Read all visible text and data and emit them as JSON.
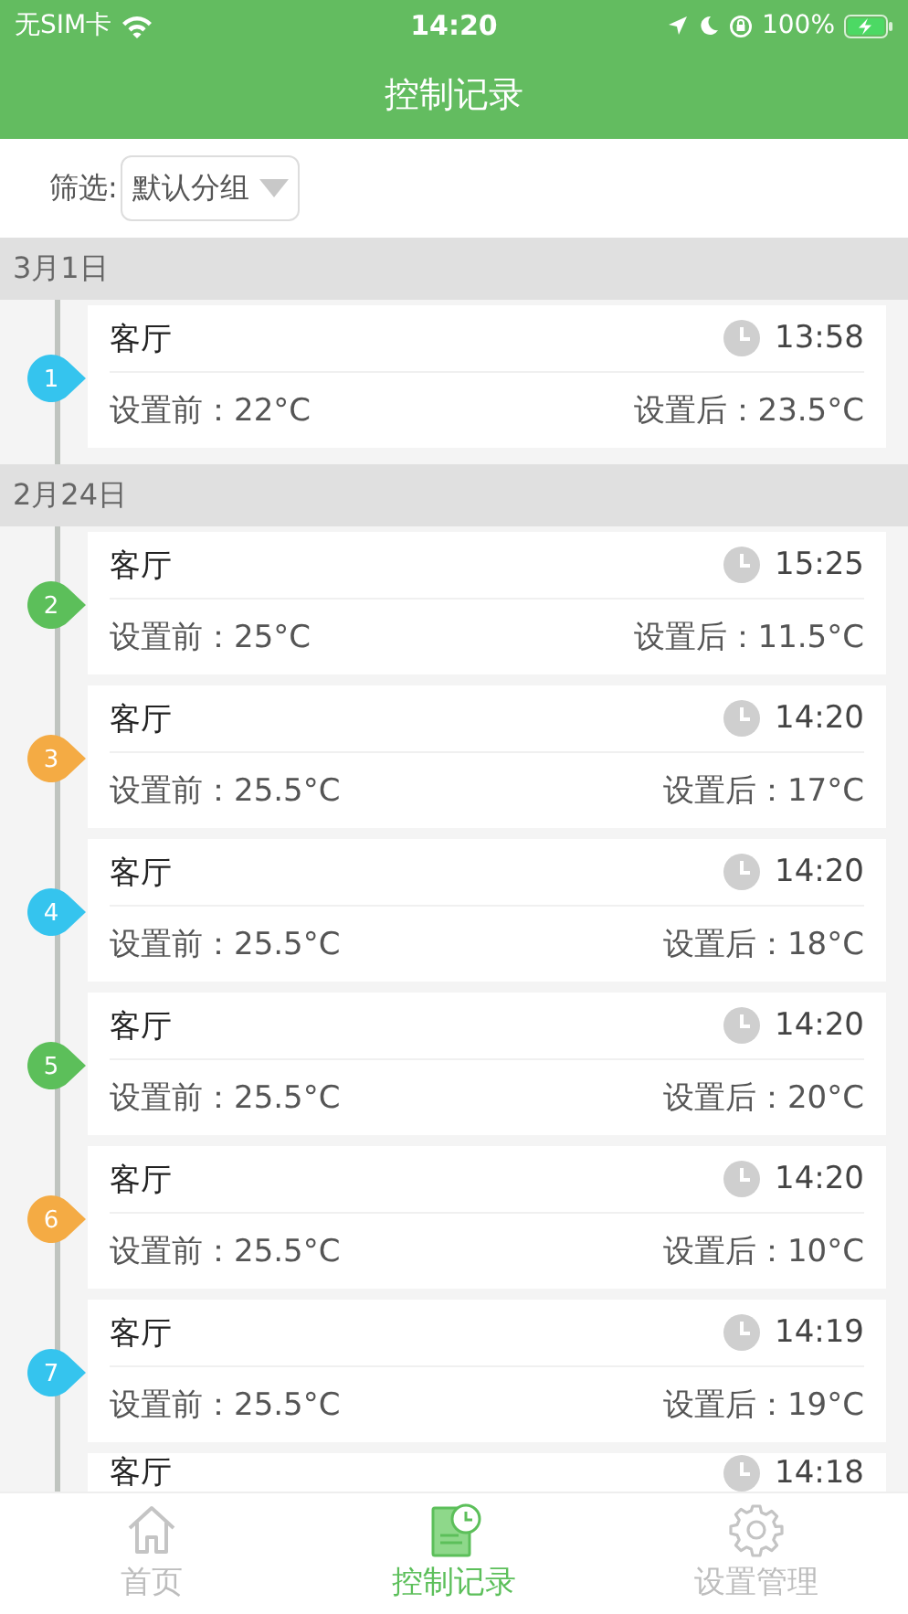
{
  "status_bar": {
    "carrier": "无SIM卡",
    "time": "14:20",
    "battery": "100%"
  },
  "header": {
    "title": "控制记录"
  },
  "filter": {
    "label": "筛选:",
    "value": "默认分组"
  },
  "groups": [
    {
      "date": "3月1日",
      "records": [
        {
          "kind": "full",
          "number": "1",
          "color": "#35c4ee",
          "room": "客厅",
          "time": "13:58",
          "before": "设置前：22°C",
          "after": "设置后：23.5°C"
        }
      ]
    },
    {
      "date": "2月24日",
      "records": [
        {
          "kind": "full",
          "number": "2",
          "color": "#5cbf5a",
          "room": "客厅",
          "time": "15:25",
          "before": "设置前：25°C",
          "after": "设置后：11.5°C"
        },
        {
          "kind": "full",
          "number": "3",
          "color": "#f4ab44",
          "room": "客厅",
          "time": "14:20",
          "before": "设置前：25.5°C",
          "after": "设置后：17°C"
        },
        {
          "kind": "full",
          "number": "4",
          "color": "#35c4ee",
          "room": "客厅",
          "time": "14:20",
          "before": "设置前：25.5°C",
          "after": "设置后：18°C"
        },
        {
          "kind": "full",
          "number": "5",
          "color": "#5cbf5a",
          "room": "客厅",
          "time": "14:20",
          "before": "设置前：25.5°C",
          "after": "设置后：20°C"
        },
        {
          "kind": "full",
          "number": "6",
          "color": "#f4ab44",
          "room": "客厅",
          "time": "14:20",
          "before": "设置前：25.5°C",
          "after": "设置后：10°C"
        },
        {
          "kind": "full",
          "number": "7",
          "color": "#35c4ee",
          "room": "客厅",
          "time": "14:19",
          "before": "设置前：25.5°C",
          "after": "设置后：19°C"
        },
        {
          "kind": "partial",
          "room": "客厅",
          "time": "14:18"
        }
      ]
    }
  ],
  "tab_bar": [
    {
      "label": "首页",
      "selected": false
    },
    {
      "label": "控制记录",
      "selected": true
    },
    {
      "label": "设置管理",
      "selected": false
    }
  ]
}
